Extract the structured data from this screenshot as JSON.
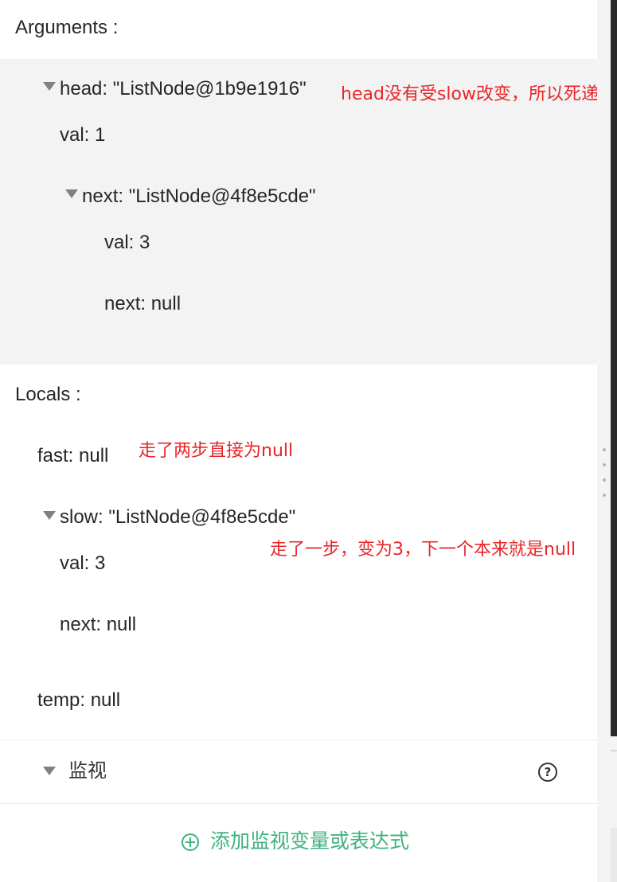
{
  "arguments": {
    "title": "Arguments :",
    "head": {
      "label": "head: \"ListNode@1b9e1916\"",
      "val": "val: 1",
      "next": {
        "label": "next: \"ListNode@4f8e5cde\"",
        "val": "val: 3",
        "next": "next: null"
      }
    }
  },
  "locals": {
    "title": "Locals :",
    "fast": "fast: null",
    "slow": {
      "label": "slow: \"ListNode@4f8e5cde\"",
      "val": "val: 3",
      "next": "next: null"
    },
    "temp": "temp: null"
  },
  "annotations": {
    "head_note": "head没有受slow改变，所以死递归",
    "fast_note": "走了两步直接为null",
    "slow_note": "走了一步，变为3，下一个本来就是null"
  },
  "watch": {
    "title": "监视",
    "help_icon": "help-circle-icon",
    "help_glyph": "?",
    "add_label": "添加监视变量或表达式",
    "add_icon": "plus-circle-icon"
  },
  "colors": {
    "annotation": "#e8262a",
    "accent_green": "#3fb27f",
    "args_background": "#f3f3f3"
  }
}
